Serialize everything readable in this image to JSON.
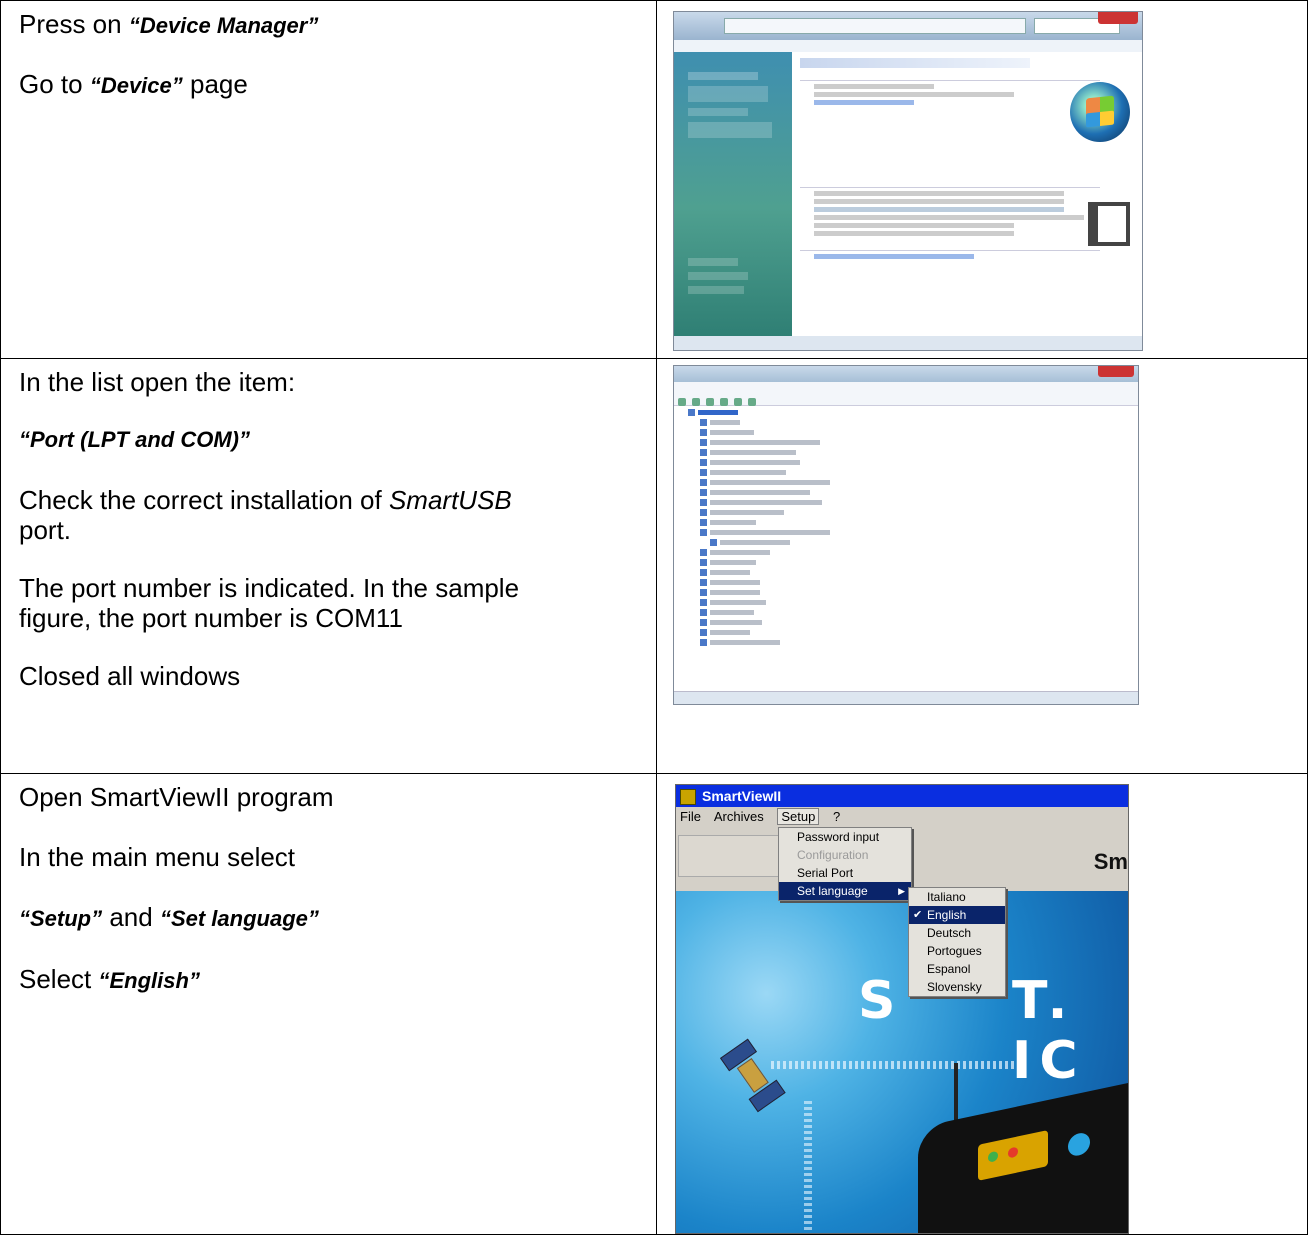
{
  "rows": [
    {
      "lines": [
        {
          "pre": "Press on ",
          "quote": "“Device Manager”",
          "post": ""
        },
        {
          "pre": "Go to ",
          "quote": "“Device”",
          "post": " page"
        }
      ]
    },
    {
      "lines": [
        {
          "text": "In the list open the item:"
        },
        {
          "quote": "“Port (LPT and COM)”"
        },
        {
          "pre": "Check the correct installation of ",
          "italic": "SmartUSB",
          "post2": "port."
        },
        {
          "text": "The port number is indicated. In the sample",
          "text2": "figure, the port number is COM11"
        },
        {
          "text": "Closed all windows"
        }
      ]
    },
    {
      "lines": [
        {
          "text": "Open SmartViewII program"
        },
        {
          "text": "In the main menu select"
        },
        {
          "quote1": "“Setup”",
          "mid": " and ",
          "quote2": "“Set language”"
        },
        {
          "pre": "Select ",
          "quote": "“English”"
        }
      ]
    }
  ],
  "shot3": {
    "title": "SmartViewII",
    "menu": [
      "File",
      "Archives",
      "Setup",
      "?"
    ],
    "setup_menu": [
      "Password input",
      "Configuration",
      "Serial Port",
      "Set language"
    ],
    "languages": [
      "Italiano",
      "English",
      "Deutsch",
      "Portogues",
      "Espanol",
      "Slovensky"
    ],
    "selected_language": "English",
    "brand_fragment": "Sm",
    "banner_left": "S",
    "banner_right": "T. IC",
    "colors": {
      "titlebar": "#0a2ee0",
      "menu_highlight": "#0a246a"
    }
  }
}
